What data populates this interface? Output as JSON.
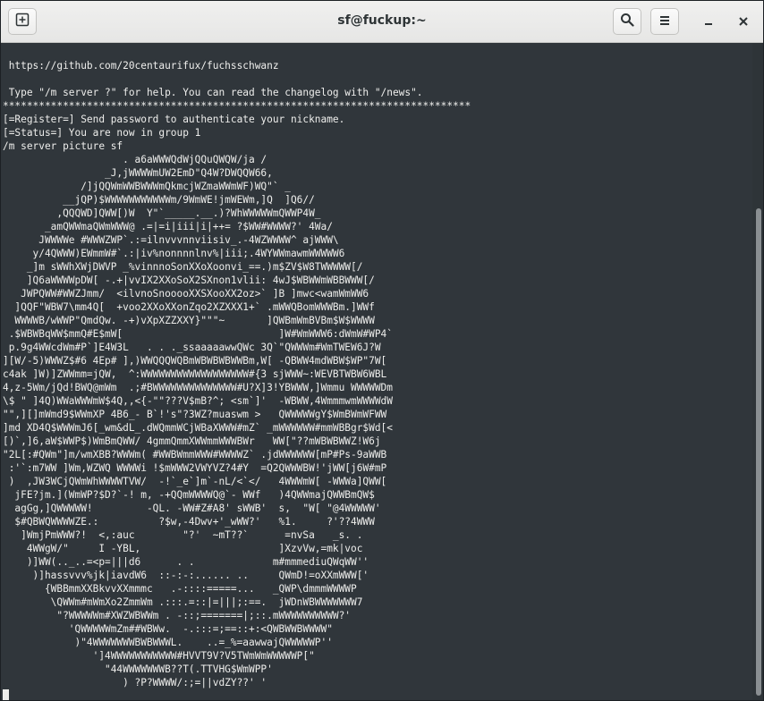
{
  "window": {
    "title": "sf@fuckup:~",
    "buttons": {
      "new_tab_icon": "new-tab-icon",
      "search_icon": "search-icon",
      "menu_icon": "hamburger-menu-icon",
      "minimize_icon": "minimize-icon",
      "close_icon": "close-icon"
    }
  },
  "terminal": {
    "lines": [
      "",
      " https://github.com/20centaurifux/fuchsschwanz",
      "",
      " Type \"/m server ?\" for help. You can read the changelog with \"/news\".",
      "******************************************************************************",
      "[=Register=] Send password to authenticate your nickname.",
      "[=Status=] You are now in group 1",
      "/m server picture sf",
      "                    . a6aWWWQdWjQQuQWQW/ja /",
      "                 _J,jWWWWmUW2EmD\"Q4W?DWQQW66,",
      "             /]jQQWmWWBWWWmQkmcjWZmaWWmWF)WQ\"` _",
      "          __jQP)$WWWWWWWWWWWm/9WmWE!jmWEWm,]Q  ]Q6//",
      "         ,QQQWD]QWW[)W  Y\"`_____.__.)?WhWWWWWmQWWP4W_",
      "       _amQWWmaQWmWWW@ .=|=i|iii|i|++= ?$WW#WWWW?' 4Wa/",
      "      JWWWWe #WWWZWP`.:=ilnvvvnnviisiv_.-4WZWWWW^ ajWWW\\",
      "     y/4QWWW)EWmmW#`.:|iv%nonnnnlnv%|iii;.4WYWWmawmWWWWW6",
      "    _]m sWWhXWjDWVP _%vinnnoSonXXoXoonvi_==.)m$ZV$W8TWWWWW[/",
      "    ]Q6aWWWWpDW[ -.+|vvIX2XXoSoX2SXnon1vlii: 4wJ$WBWWmWBBWWW[/",
      "   JWPQWW#WWZJmm/  <ilvnoSnooooXXSXooXX2oz>` ]B ]mwc<wamWmWW6",
      "  ]QQF\"WBW7\\mm4Q[  +voo2XXoXXonZqo2XZXXX1+` .mWWQBomWWWBm.]WWf",
      "  WWWWB/wWWP\"QmdQw. -+)vXpXZZXXY}\"\"\"~       ]QWBmWmBVBm$W$WWWW",
      " .$WBWBqWW$mmQ#E$mW[                          ]W#WmWWW6:dWmW#WP4`",
      " p.9g4WWcdWm#P`]E4W3L   . . ._ssaaaaawwQWc 3Q`\"QWWWm#WmTWEW6J?W",
      "][W/-5)WWWZ$#6 4Ep# ],)WWQQQWQBmWBWBWBWWBm,W[ -QBWW4mdWBW$WP\"7W[",
      "c4ak ]W)]ZWWmm=jQW,  ^:WWWWWWWWWWWWWWWWWW#{3 sjWWW~:WEVBTWBW6WBL",
      "4,z-5Wm/jQd!BWQ@mWm  .;#BWWWWWWWWWWWWWW#U?X]3!YBWWW,]Wmmu WWWWWDm",
      "\\$ \" ]4Q)WWaWWWmW$4Q,,<{-\"\"???V$mB?^; <sm`]'  -WBWW,4WmmmwmWWWWdW",
      "\"\",][]mWmd9$WWmXP 4B6_- B`!'s\"?3WZ?muaswm >   QWWWWWgY$WmBWmWFWW",
      "]md XD4Q$WWWmJ6[_wm&dL_.dWQmmWCjWBaXWWW#mZ` _mWWWWWW#mmWBBgr$Wd[<",
      "[)`,]6,aW$WWP$)WmBmQWW/ 4gmmQmmXWWmmWWWBWr   WW[\"??mWBWBWWZ!W6j",
      "\"2L[:#QWm\"]m/wmXBB?WWWm( #WWBWmmWWW#WWWWZ` .jdWWWWWW[mP#Ps-9aWWB",
      " :'`:m7WW ]Wm,WZWQ WWWWi !$mWWW2VWYVZ?4#Y  =Q2QWWWBW!'jWW[j6W#mP",
      " )  ,JW3WCjQWmWhWWWWTVW/  -!`_e`]m`-nL/<`</   4WWWmW[ -WWWa]QWW[",
      "  jFE?jm.](WmWP?$D?`-! m, -+QQmWWWWQ@`- WWf   )4QWWmajQWWBmQW$",
      "  agGg,]QWWWWW!         -QL. -WW#Z#A8' sWWB'  s,  \"W[ \"@4WWWWW'",
      "  $#QBWQWWWWZE.:          ?$w,-4Dwv+'_wWW?'   %1.     ?'??4WWW",
      "   ]WmjPmWWW?!  <,:auc        \"?'  ~mT??`      =nvSa   _s. .",
      "    4WWgW/\"     I -YBL,                       ]XzvVw,=mk|voc",
      "    )]WW(.._..=<p=|||d6      . .             m#mmmediuQWqWW''",
      "     )]hassvvv%jk|iavdW6  ::-:-:...... ..     QWmD!=oXXmWWW['",
      "       {WBBmmXXBkvvXXmmmc   .-::::=====...   _QWP\\dmmmWWWWP",
      "        \\QWWm#mWmXo2ZmmWm .:::.=::|=|||;:==.  jWDnWBWWWWWWW7",
      "         \"?WWWWWm#XWZWBWWm . -::;=======|;::.mWWWWWWWWWW?'",
      "           'QWWWWWmZm##WBWw.  -.:::=;==::+:<QWBWWBWWWW\"",
      "            )\"4WWWWWWWBWBWWWL.    ..=_%=aawwajQWWWWWP''",
      "               ']4WWWWWWWWWWW#HVVT9V?V5TWmWmWWWWWP[\"",
      "                 \"44WWWWWWWB??T(.TTVHG$WmWPP'",
      "                    ) ?P?WWWW/:;=||vdZY??' '",
      ""
    ]
  }
}
